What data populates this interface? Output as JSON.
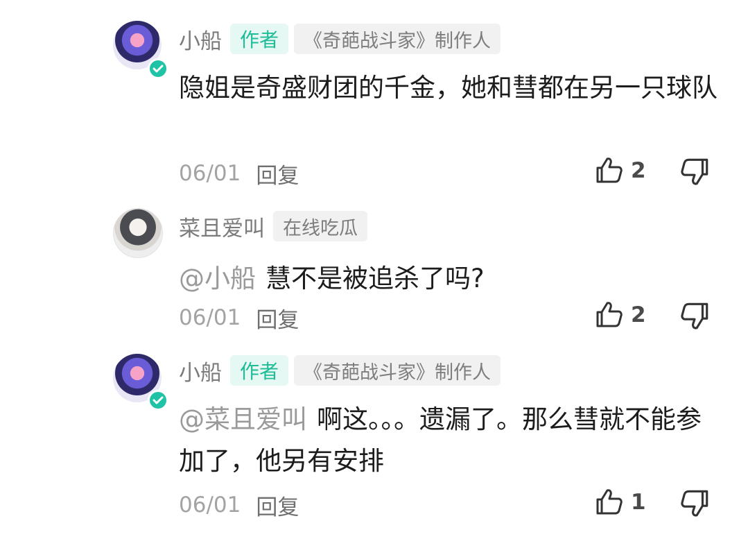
{
  "comments": [
    {
      "name": "小船",
      "author_badge": "作者",
      "title_badge": "《奇葩战斗家》制作人",
      "mention": "",
      "text": "隐姐是奇盛财团的千金，她和彗都在另一只球队",
      "date": "06/01",
      "reply": "回复",
      "likes": "2"
    },
    {
      "name": "菜且爱叫",
      "title_badge": "在线吃瓜",
      "mention": "@小船",
      "text": "慧不是被追杀了吗?",
      "date": "06/01",
      "reply": "回复",
      "likes": "2"
    },
    {
      "name": "小船",
      "author_badge": "作者",
      "title_badge": "《奇葩战斗家》制作人",
      "mention": "@菜且爱叫",
      "text": "啊这。。。遗漏了。那么彗就不能参加了，他另有安排",
      "date": "06/01",
      "reply": "回复",
      "likes": "1"
    }
  ],
  "icons": {
    "like": "thumbs-up-icon",
    "dislike": "thumbs-down-icon",
    "verified": "verified-check-icon"
  },
  "colors": {
    "accent": "#1fbc98",
    "verified": "#21c3a6",
    "muted": "#a3a3a3"
  }
}
